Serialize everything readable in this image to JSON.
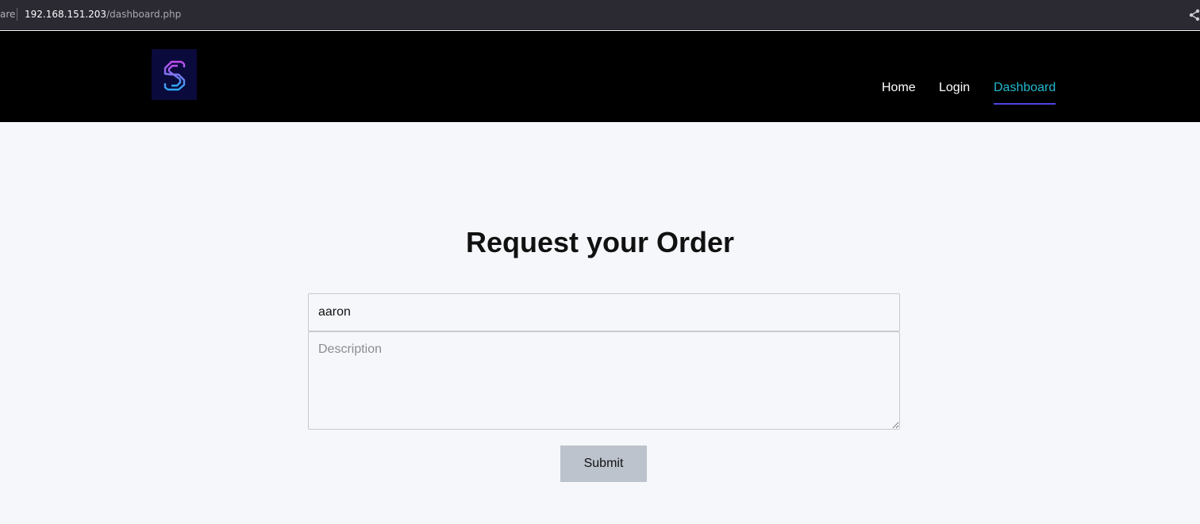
{
  "browser": {
    "prefix_fragment": "are",
    "url_host": "192.168.151.203",
    "url_path": "/dashboard.php",
    "share_icon": "share-icon"
  },
  "header": {
    "logo_icon": "s-logo-icon",
    "nav": {
      "home": "Home",
      "login": "Login",
      "dashboard": "Dashboard",
      "active": "Dashboard"
    },
    "colors": {
      "background": "#000000",
      "active_link": "#22b8cf",
      "active_underline": "#4f46e5"
    }
  },
  "main": {
    "title": "Request your Order",
    "name_value": "aaron",
    "description_placeholder": "Description",
    "submit_label": "Submit"
  }
}
